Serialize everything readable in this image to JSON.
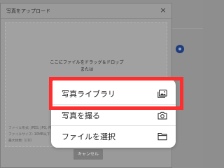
{
  "modal": {
    "title": "写真をアップロード",
    "close_glyph": "×",
    "drop_zone": {
      "line1": "ここにファイルをドラッグ＆ドロップ",
      "line2": "または",
      "file_info": [
        "ファイル形式: JPEG, JPG, PNG",
        "ファイルサイズ: 10MB以下",
        "最大枚数: 1/10"
      ]
    },
    "cancel_label": "キャンセル"
  },
  "action_sheet": {
    "items": [
      {
        "label": "写真ライブラリ",
        "icon": "photo-library-icon"
      },
      {
        "label": "写真を撮る",
        "icon": "camera-icon"
      },
      {
        "label": "ファイルを選択",
        "icon": "folder-icon"
      }
    ]
  },
  "colors": {
    "highlight": "#ff2d2d",
    "dim_overlay": "#8e8e8e",
    "accent_dot": "#1f3c7a"
  }
}
